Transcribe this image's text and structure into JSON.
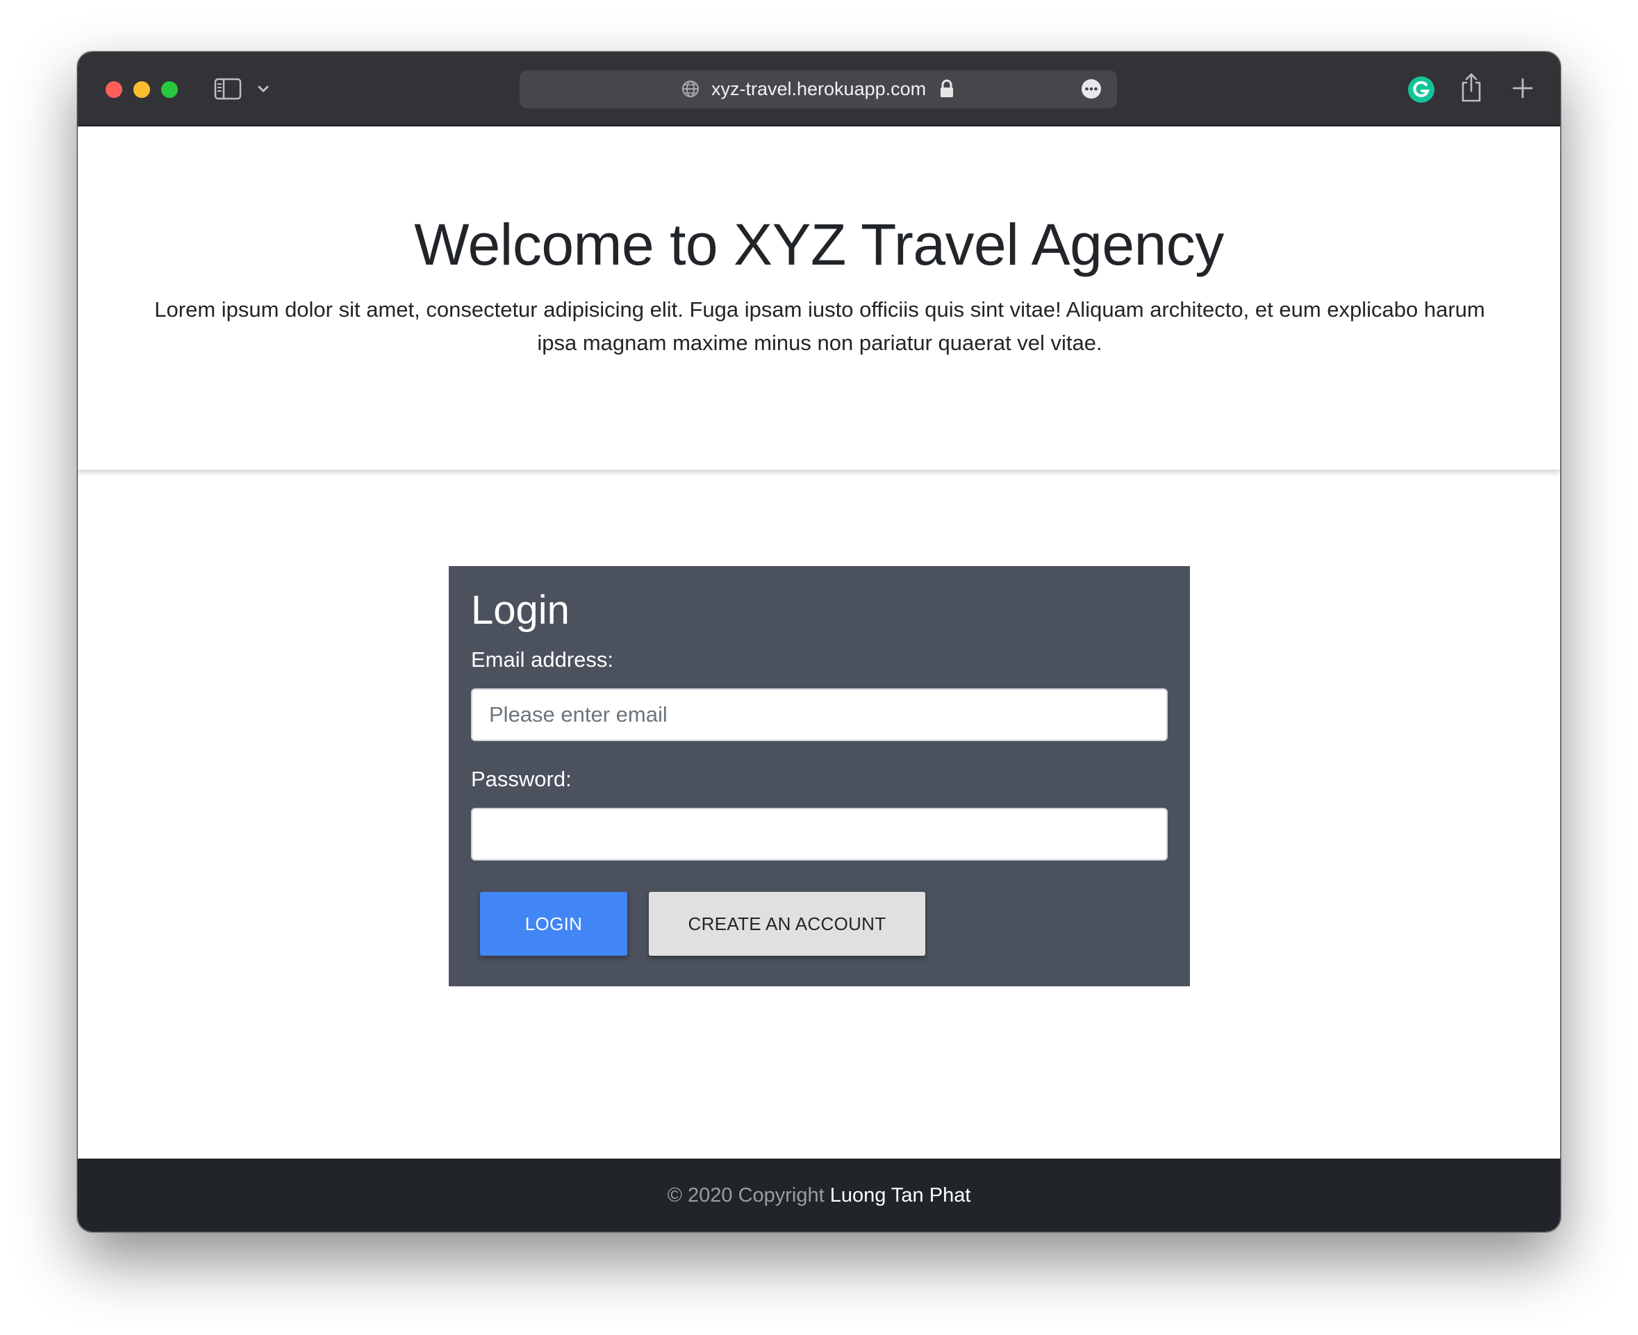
{
  "browser": {
    "url": "xyz-travel.herokuapp.com",
    "icons": [
      "sidebar-icon",
      "chevron-down-icon",
      "globe-icon",
      "lock-icon",
      "more-icon",
      "grammarly-icon",
      "share-icon",
      "plus-icon"
    ]
  },
  "hero": {
    "title": "Welcome to XYZ Travel Agency",
    "text": "Lorem ipsum dolor sit amet, consectetur adipisicing elit. Fuga ipsam iusto officiis quis sint vitae! Aliquam architecto, et eum explicabo harum ipsa magnam maxime minus non pariatur quaerat vel vitae."
  },
  "login": {
    "title": "Login",
    "email_label": "Email address:",
    "email_placeholder": "Please enter email",
    "email_value": "",
    "password_label": "Password:",
    "password_value": "",
    "login_button": "LOGIN",
    "create_button": "CREATE AN ACCOUNT"
  },
  "footer": {
    "copyright": "© 2020 Copyright",
    "author": "Luong Tan Phat"
  },
  "colors": {
    "titlebar": "#333237",
    "card": "#4b515d",
    "primary": "#4285f4",
    "secondary": "#e0e0e0",
    "footer": "#212529"
  }
}
